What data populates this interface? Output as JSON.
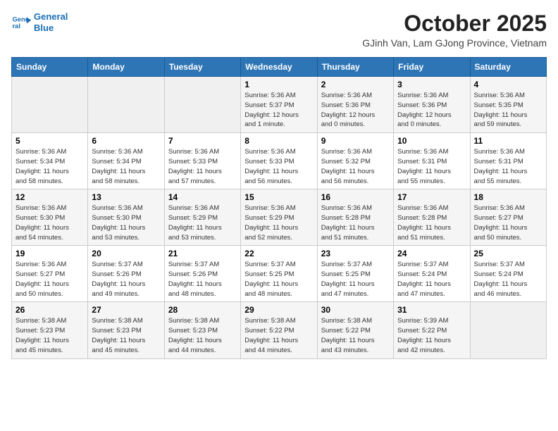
{
  "logo": {
    "line1": "General",
    "line2": "Blue"
  },
  "title": "October 2025",
  "subtitle": "GJinh Van, Lam GJong Province, Vietnam",
  "days_of_week": [
    "Sunday",
    "Monday",
    "Tuesday",
    "Wednesday",
    "Thursday",
    "Friday",
    "Saturday"
  ],
  "weeks": [
    [
      {
        "day": "",
        "info": ""
      },
      {
        "day": "",
        "info": ""
      },
      {
        "day": "",
        "info": ""
      },
      {
        "day": "1",
        "info": "Sunrise: 5:36 AM\nSunset: 5:37 PM\nDaylight: 12 hours\nand 1 minute."
      },
      {
        "day": "2",
        "info": "Sunrise: 5:36 AM\nSunset: 5:36 PM\nDaylight: 12 hours\nand 0 minutes."
      },
      {
        "day": "3",
        "info": "Sunrise: 5:36 AM\nSunset: 5:36 PM\nDaylight: 12 hours\nand 0 minutes."
      },
      {
        "day": "4",
        "info": "Sunrise: 5:36 AM\nSunset: 5:35 PM\nDaylight: 11 hours\nand 59 minutes."
      }
    ],
    [
      {
        "day": "5",
        "info": "Sunrise: 5:36 AM\nSunset: 5:34 PM\nDaylight: 11 hours\nand 58 minutes."
      },
      {
        "day": "6",
        "info": "Sunrise: 5:36 AM\nSunset: 5:34 PM\nDaylight: 11 hours\nand 58 minutes."
      },
      {
        "day": "7",
        "info": "Sunrise: 5:36 AM\nSunset: 5:33 PM\nDaylight: 11 hours\nand 57 minutes."
      },
      {
        "day": "8",
        "info": "Sunrise: 5:36 AM\nSunset: 5:33 PM\nDaylight: 11 hours\nand 56 minutes."
      },
      {
        "day": "9",
        "info": "Sunrise: 5:36 AM\nSunset: 5:32 PM\nDaylight: 11 hours\nand 56 minutes."
      },
      {
        "day": "10",
        "info": "Sunrise: 5:36 AM\nSunset: 5:31 PM\nDaylight: 11 hours\nand 55 minutes."
      },
      {
        "day": "11",
        "info": "Sunrise: 5:36 AM\nSunset: 5:31 PM\nDaylight: 11 hours\nand 55 minutes."
      }
    ],
    [
      {
        "day": "12",
        "info": "Sunrise: 5:36 AM\nSunset: 5:30 PM\nDaylight: 11 hours\nand 54 minutes."
      },
      {
        "day": "13",
        "info": "Sunrise: 5:36 AM\nSunset: 5:30 PM\nDaylight: 11 hours\nand 53 minutes."
      },
      {
        "day": "14",
        "info": "Sunrise: 5:36 AM\nSunset: 5:29 PM\nDaylight: 11 hours\nand 53 minutes."
      },
      {
        "day": "15",
        "info": "Sunrise: 5:36 AM\nSunset: 5:29 PM\nDaylight: 11 hours\nand 52 minutes."
      },
      {
        "day": "16",
        "info": "Sunrise: 5:36 AM\nSunset: 5:28 PM\nDaylight: 11 hours\nand 51 minutes."
      },
      {
        "day": "17",
        "info": "Sunrise: 5:36 AM\nSunset: 5:28 PM\nDaylight: 11 hours\nand 51 minutes."
      },
      {
        "day": "18",
        "info": "Sunrise: 5:36 AM\nSunset: 5:27 PM\nDaylight: 11 hours\nand 50 minutes."
      }
    ],
    [
      {
        "day": "19",
        "info": "Sunrise: 5:36 AM\nSunset: 5:27 PM\nDaylight: 11 hours\nand 50 minutes."
      },
      {
        "day": "20",
        "info": "Sunrise: 5:37 AM\nSunset: 5:26 PM\nDaylight: 11 hours\nand 49 minutes."
      },
      {
        "day": "21",
        "info": "Sunrise: 5:37 AM\nSunset: 5:26 PM\nDaylight: 11 hours\nand 48 minutes."
      },
      {
        "day": "22",
        "info": "Sunrise: 5:37 AM\nSunset: 5:25 PM\nDaylight: 11 hours\nand 48 minutes."
      },
      {
        "day": "23",
        "info": "Sunrise: 5:37 AM\nSunset: 5:25 PM\nDaylight: 11 hours\nand 47 minutes."
      },
      {
        "day": "24",
        "info": "Sunrise: 5:37 AM\nSunset: 5:24 PM\nDaylight: 11 hours\nand 47 minutes."
      },
      {
        "day": "25",
        "info": "Sunrise: 5:37 AM\nSunset: 5:24 PM\nDaylight: 11 hours\nand 46 minutes."
      }
    ],
    [
      {
        "day": "26",
        "info": "Sunrise: 5:38 AM\nSunset: 5:23 PM\nDaylight: 11 hours\nand 45 minutes."
      },
      {
        "day": "27",
        "info": "Sunrise: 5:38 AM\nSunset: 5:23 PM\nDaylight: 11 hours\nand 45 minutes."
      },
      {
        "day": "28",
        "info": "Sunrise: 5:38 AM\nSunset: 5:23 PM\nDaylight: 11 hours\nand 44 minutes."
      },
      {
        "day": "29",
        "info": "Sunrise: 5:38 AM\nSunset: 5:22 PM\nDaylight: 11 hours\nand 44 minutes."
      },
      {
        "day": "30",
        "info": "Sunrise: 5:38 AM\nSunset: 5:22 PM\nDaylight: 11 hours\nand 43 minutes."
      },
      {
        "day": "31",
        "info": "Sunrise: 5:39 AM\nSunset: 5:22 PM\nDaylight: 11 hours\nand 42 minutes."
      },
      {
        "day": "",
        "info": ""
      }
    ]
  ]
}
